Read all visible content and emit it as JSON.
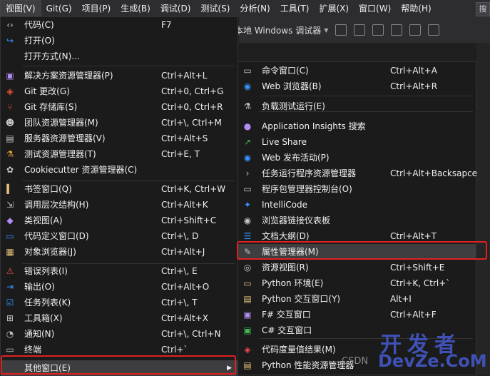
{
  "menubar": {
    "items": [
      "视图(V)",
      "Git(G)",
      "项目(P)",
      "生成(B)",
      "调试(D)",
      "测试(S)",
      "分析(N)",
      "工具(T)",
      "扩展(X)",
      "窗口(W)",
      "帮助(H)"
    ],
    "search_label": "搜"
  },
  "toolbar": {
    "run_target": "本地 Windows 调试器"
  },
  "view_menu": {
    "items": [
      {
        "icon": "code-icon",
        "label": "代码(C)",
        "shortcut": "F7"
      },
      {
        "icon": "open-icon",
        "label": "打开(O)",
        "shortcut": ""
      },
      {
        "icon": "",
        "label": "打开方式(N)...",
        "shortcut": ""
      },
      {
        "icon": "solution-explorer-icon",
        "label": "解决方案资源管理器(P)",
        "shortcut": "Ctrl+Alt+L"
      },
      {
        "icon": "git-changes-icon",
        "label": "Git 更改(G)",
        "shortcut": "Ctrl+0, Ctrl+G"
      },
      {
        "icon": "git-repository-icon",
        "label": "Git 存储库(S)",
        "shortcut": "Ctrl+0, Ctrl+R"
      },
      {
        "icon": "team-explorer-icon",
        "label": "团队资源管理器(M)",
        "shortcut": "Ctrl+\\, Ctrl+M"
      },
      {
        "icon": "server-explorer-icon",
        "label": "服务器资源管理器(V)",
        "shortcut": "Ctrl+Alt+S"
      },
      {
        "icon": "test-explorer-icon",
        "label": "测试资源管理器(T)",
        "shortcut": "Ctrl+E, T"
      },
      {
        "icon": "cookiecutter-icon",
        "label": "Cookiecutter 资源管理器(C)",
        "shortcut": ""
      },
      {
        "icon": "bookmark-icon",
        "label": "书签窗口(Q)",
        "shortcut": "Ctrl+K, Ctrl+W"
      },
      {
        "icon": "call-hierarchy-icon",
        "label": "调用层次结构(H)",
        "shortcut": "Ctrl+Alt+K"
      },
      {
        "icon": "class-view-icon",
        "label": "类视图(A)",
        "shortcut": "Ctrl+Shift+C"
      },
      {
        "icon": "code-definition-icon",
        "label": "代码定义窗口(D)",
        "shortcut": "Ctrl+\\, D"
      },
      {
        "icon": "object-browser-icon",
        "label": "对象浏览器(J)",
        "shortcut": "Ctrl+Alt+J"
      },
      {
        "icon": "error-list-icon",
        "label": "错误列表(I)",
        "shortcut": "Ctrl+\\, E"
      },
      {
        "icon": "output-icon",
        "label": "输出(O)",
        "shortcut": "Ctrl+Alt+O"
      },
      {
        "icon": "task-list-icon",
        "label": "任务列表(K)",
        "shortcut": "Ctrl+\\, T"
      },
      {
        "icon": "toolbox-icon",
        "label": "工具箱(X)",
        "shortcut": "Ctrl+Alt+X"
      },
      {
        "icon": "bell-icon",
        "label": "通知(N)",
        "shortcut": "Ctrl+\\, Ctrl+N"
      },
      {
        "icon": "terminal-icon",
        "label": "终端",
        "shortcut": "Ctrl+`"
      },
      {
        "icon": "",
        "label": "其他窗口(E)",
        "shortcut": ""
      }
    ]
  },
  "other_windows_menu": {
    "items": [
      {
        "icon": "command-window-icon",
        "label": "命令窗口(C)",
        "shortcut": "Ctrl+Alt+A"
      },
      {
        "icon": "web-browser-icon",
        "label": "Web 浏览器(B)",
        "shortcut": "Ctrl+Alt+R"
      },
      {
        "icon": "load-test-icon",
        "label": "负载测试运行(E)",
        "shortcut": ""
      },
      {
        "icon": "app-insights-icon",
        "label": "Application Insights 搜索",
        "shortcut": ""
      },
      {
        "icon": "live-share-icon",
        "label": "Live Share",
        "shortcut": ""
      },
      {
        "icon": "web-publish-icon",
        "label": "Web 发布活动(P)",
        "shortcut": ""
      },
      {
        "icon": "task-runner-icon",
        "label": "任务运行程序资源管理器",
        "shortcut": "Ctrl+Alt+Backsapce"
      },
      {
        "icon": "package-console-icon",
        "label": "程序包管理器控制台(O)",
        "shortcut": ""
      },
      {
        "icon": "intellicode-icon",
        "label": "IntelliCode",
        "shortcut": ""
      },
      {
        "icon": "browser-link-icon",
        "label": "浏览器链接仪表板",
        "shortcut": ""
      },
      {
        "icon": "document-outline-icon",
        "label": "文档大纲(D)",
        "shortcut": "Ctrl+Alt+T"
      },
      {
        "icon": "wrench-icon",
        "label": "属性管理器(M)",
        "shortcut": ""
      },
      {
        "icon": "resource-view-icon",
        "label": "资源视图(R)",
        "shortcut": "Ctrl+Shift+E"
      },
      {
        "icon": "python-env-icon",
        "label": "Python 环境(E)",
        "shortcut": "Ctrl+K, Ctrl+`"
      },
      {
        "icon": "python-interactive-icon",
        "label": "Python 交互窗口(Y)",
        "shortcut": "Alt+I"
      },
      {
        "icon": "fsharp-interactive-icon",
        "label": "F# 交互窗口",
        "shortcut": "Ctrl+Alt+F"
      },
      {
        "icon": "csharp-interactive-icon",
        "label": "C# 交互窗口",
        "shortcut": ""
      },
      {
        "icon": "code-metrics-icon",
        "label": "代码度量值结果(M)",
        "shortcut": ""
      },
      {
        "icon": "python-profiler-icon",
        "label": "Python 性能资源管理器",
        "shortcut": ""
      }
    ]
  },
  "watermark": {
    "csdn": "CSDN",
    "top": "开发者",
    "bottom": "DevZe.CoM"
  },
  "colors": {
    "highlight_box": "#e02020",
    "watermark": "#3f51b5",
    "menu_bg": "#1b1b1c"
  }
}
